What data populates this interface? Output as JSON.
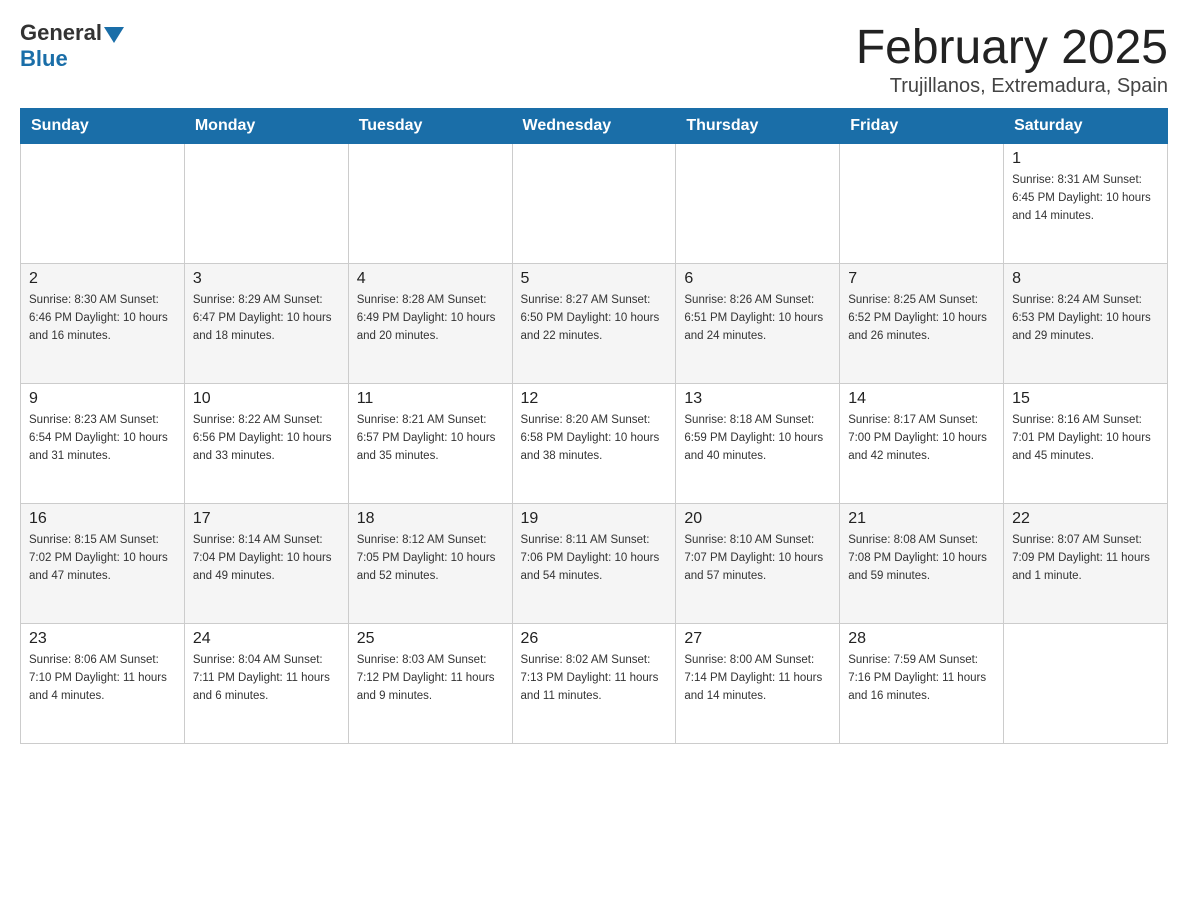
{
  "header": {
    "logo_general": "General",
    "logo_blue": "Blue",
    "title": "February 2025",
    "subtitle": "Trujillanos, Extremadura, Spain"
  },
  "days_of_week": [
    "Sunday",
    "Monday",
    "Tuesday",
    "Wednesday",
    "Thursday",
    "Friday",
    "Saturday"
  ],
  "weeks": [
    {
      "id": "week-1",
      "days": [
        {
          "number": "",
          "info": ""
        },
        {
          "number": "",
          "info": ""
        },
        {
          "number": "",
          "info": ""
        },
        {
          "number": "",
          "info": ""
        },
        {
          "number": "",
          "info": ""
        },
        {
          "number": "",
          "info": ""
        },
        {
          "number": "1",
          "info": "Sunrise: 8:31 AM\nSunset: 6:45 PM\nDaylight: 10 hours and 14 minutes."
        }
      ]
    },
    {
      "id": "week-2",
      "days": [
        {
          "number": "2",
          "info": "Sunrise: 8:30 AM\nSunset: 6:46 PM\nDaylight: 10 hours and 16 minutes."
        },
        {
          "number": "3",
          "info": "Sunrise: 8:29 AM\nSunset: 6:47 PM\nDaylight: 10 hours and 18 minutes."
        },
        {
          "number": "4",
          "info": "Sunrise: 8:28 AM\nSunset: 6:49 PM\nDaylight: 10 hours and 20 minutes."
        },
        {
          "number": "5",
          "info": "Sunrise: 8:27 AM\nSunset: 6:50 PM\nDaylight: 10 hours and 22 minutes."
        },
        {
          "number": "6",
          "info": "Sunrise: 8:26 AM\nSunset: 6:51 PM\nDaylight: 10 hours and 24 minutes."
        },
        {
          "number": "7",
          "info": "Sunrise: 8:25 AM\nSunset: 6:52 PM\nDaylight: 10 hours and 26 minutes."
        },
        {
          "number": "8",
          "info": "Sunrise: 8:24 AM\nSunset: 6:53 PM\nDaylight: 10 hours and 29 minutes."
        }
      ]
    },
    {
      "id": "week-3",
      "days": [
        {
          "number": "9",
          "info": "Sunrise: 8:23 AM\nSunset: 6:54 PM\nDaylight: 10 hours and 31 minutes."
        },
        {
          "number": "10",
          "info": "Sunrise: 8:22 AM\nSunset: 6:56 PM\nDaylight: 10 hours and 33 minutes."
        },
        {
          "number": "11",
          "info": "Sunrise: 8:21 AM\nSunset: 6:57 PM\nDaylight: 10 hours and 35 minutes."
        },
        {
          "number": "12",
          "info": "Sunrise: 8:20 AM\nSunset: 6:58 PM\nDaylight: 10 hours and 38 minutes."
        },
        {
          "number": "13",
          "info": "Sunrise: 8:18 AM\nSunset: 6:59 PM\nDaylight: 10 hours and 40 minutes."
        },
        {
          "number": "14",
          "info": "Sunrise: 8:17 AM\nSunset: 7:00 PM\nDaylight: 10 hours and 42 minutes."
        },
        {
          "number": "15",
          "info": "Sunrise: 8:16 AM\nSunset: 7:01 PM\nDaylight: 10 hours and 45 minutes."
        }
      ]
    },
    {
      "id": "week-4",
      "days": [
        {
          "number": "16",
          "info": "Sunrise: 8:15 AM\nSunset: 7:02 PM\nDaylight: 10 hours and 47 minutes."
        },
        {
          "number": "17",
          "info": "Sunrise: 8:14 AM\nSunset: 7:04 PM\nDaylight: 10 hours and 49 minutes."
        },
        {
          "number": "18",
          "info": "Sunrise: 8:12 AM\nSunset: 7:05 PM\nDaylight: 10 hours and 52 minutes."
        },
        {
          "number": "19",
          "info": "Sunrise: 8:11 AM\nSunset: 7:06 PM\nDaylight: 10 hours and 54 minutes."
        },
        {
          "number": "20",
          "info": "Sunrise: 8:10 AM\nSunset: 7:07 PM\nDaylight: 10 hours and 57 minutes."
        },
        {
          "number": "21",
          "info": "Sunrise: 8:08 AM\nSunset: 7:08 PM\nDaylight: 10 hours and 59 minutes."
        },
        {
          "number": "22",
          "info": "Sunrise: 8:07 AM\nSunset: 7:09 PM\nDaylight: 11 hours and 1 minute."
        }
      ]
    },
    {
      "id": "week-5",
      "days": [
        {
          "number": "23",
          "info": "Sunrise: 8:06 AM\nSunset: 7:10 PM\nDaylight: 11 hours and 4 minutes."
        },
        {
          "number": "24",
          "info": "Sunrise: 8:04 AM\nSunset: 7:11 PM\nDaylight: 11 hours and 6 minutes."
        },
        {
          "number": "25",
          "info": "Sunrise: 8:03 AM\nSunset: 7:12 PM\nDaylight: 11 hours and 9 minutes."
        },
        {
          "number": "26",
          "info": "Sunrise: 8:02 AM\nSunset: 7:13 PM\nDaylight: 11 hours and 11 minutes."
        },
        {
          "number": "27",
          "info": "Sunrise: 8:00 AM\nSunset: 7:14 PM\nDaylight: 11 hours and 14 minutes."
        },
        {
          "number": "28",
          "info": "Sunrise: 7:59 AM\nSunset: 7:16 PM\nDaylight: 11 hours and 16 minutes."
        },
        {
          "number": "",
          "info": ""
        }
      ]
    }
  ]
}
